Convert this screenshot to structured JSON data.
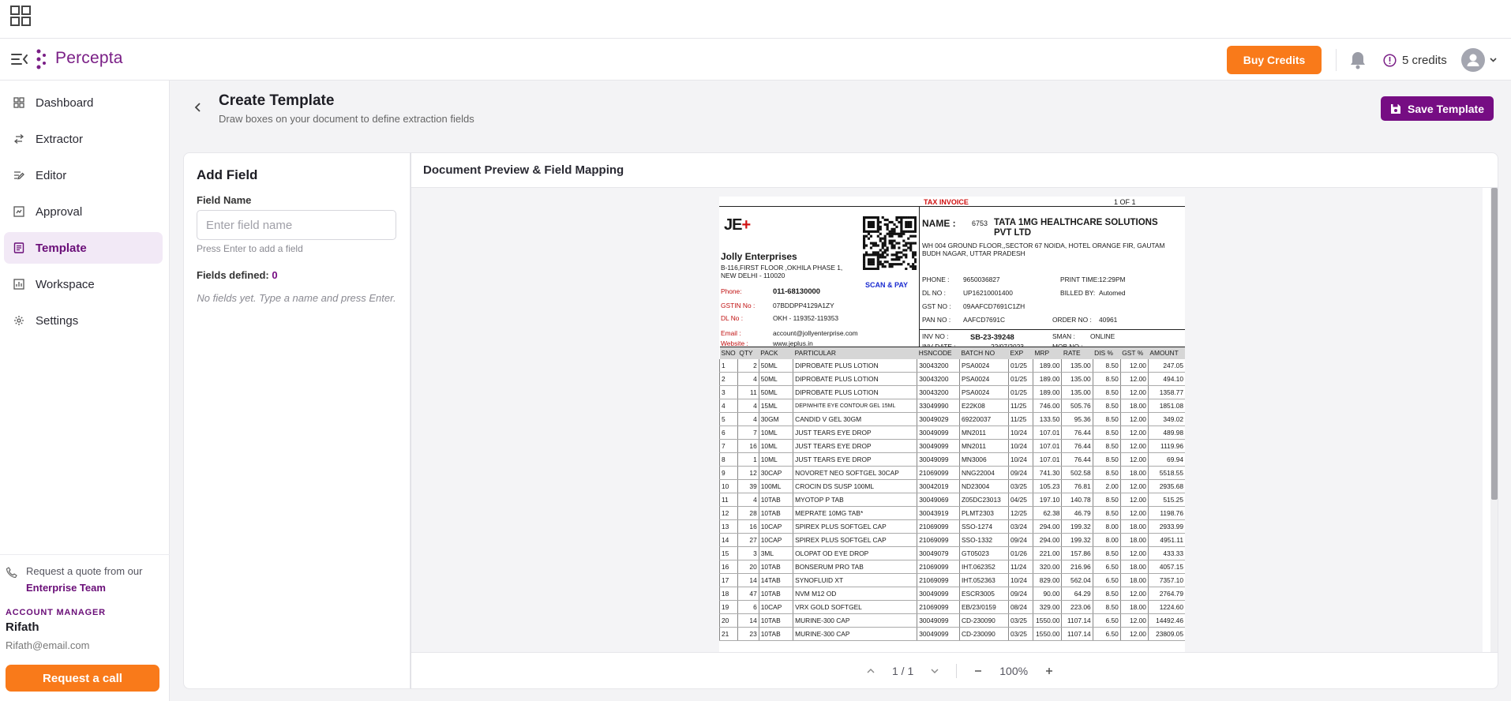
{
  "app": {
    "brand": "Percepta",
    "buy_credits": "Buy Credits",
    "credits": "5 credits"
  },
  "sidebar": {
    "items": [
      {
        "label": "Dashboard",
        "icon": "dashboard-icon"
      },
      {
        "label": "Extractor",
        "icon": "arrows-icon"
      },
      {
        "label": "Editor",
        "icon": "edit-list-icon"
      },
      {
        "label": "Approval",
        "icon": "approval-icon"
      },
      {
        "label": "Template",
        "icon": "template-icon",
        "active": true
      },
      {
        "label": "Workspace",
        "icon": "workspace-icon"
      },
      {
        "label": "Settings",
        "icon": "gear-icon"
      }
    ],
    "quote_text": "Request a quote from our",
    "quote_link": "Enterprise Team",
    "account_label": "ACCOUNT MANAGER",
    "account_name": "Rifath",
    "account_email": "Rifath@email.com",
    "request_call": "Request a call"
  },
  "main": {
    "title": "Create Template",
    "subtitle": "Draw boxes on your document to define extraction fields",
    "save_label": "Save Template"
  },
  "add_field": {
    "title": "Add Field",
    "field_label": "Field Name",
    "placeholder": "Enter field name",
    "hint": "Press Enter to add a field",
    "defined_label": "Fields defined:",
    "defined_count": "0",
    "empty": "No fields yet. Type a name and press Enter."
  },
  "preview": {
    "title": "Document Preview & Field Mapping",
    "page_indicator": "1 / 1",
    "zoom": "100%"
  },
  "invoice": {
    "tax_invoice": "TAX INVOICE",
    "page_of": "1 OF   1",
    "seller": {
      "name": "Jolly Enterprises",
      "address": "B-116,FIRST FLOOR ,OKHILA PHASE 1, NEW DELHI - 110020",
      "phone_label": "Phone:",
      "phone": "011-68130000",
      "gstin_label": "GSTIN No :",
      "gstin": "07BDDPP4129A1ZY",
      "dl_label": "DL No :",
      "dl": "OKH - 119352-119353",
      "email_label": "Email :",
      "email": "account@jollyenterprise.com",
      "website_label": "Website :",
      "website": "www.jeplus.in",
      "scan_pay": "SCAN & PAY"
    },
    "buyer": {
      "name_label": "NAME  :",
      "code": "6753",
      "name": "TATA 1MG HEALTHCARE SOLUTIONS PVT LTD",
      "address": "WH 004 GROUND FLOOR,,SECTOR 67 NOIDA, HOTEL ORANGE FIR, GAUTAM BUDH NAGAR, UTTAR PRADESH",
      "phone_label": "PHONE   :",
      "phone": "9650036827",
      "print_label": "PRINT TIME:",
      "print_time": "12:29PM",
      "dl_label": "DL NO   :",
      "dl": "UP16210001400",
      "billed_label": "BILLED BY:",
      "billed_by": "Automed",
      "gst_label": "GST NO  :",
      "gst": "09AAFCD7691C1ZH",
      "pan_label": "PAN NO  :",
      "pan": "AAFCD7691C",
      "order_label": "ORDER NO  :",
      "order": "40961",
      "inv_no_label": "INV NO    :",
      "inv_no": "SB-23-39248",
      "sman_label": "SMAN    :",
      "sman": "ONLINE",
      "inv_date_label": "INV DATE  :",
      "inv_date": "22/07/2023",
      "mob_label": "MOB NO  :",
      "mob": ""
    },
    "columns": [
      "SNO",
      "QTY",
      "PACK",
      "PARTICULAR",
      "HSNCODE",
      "BATCH NO",
      "EXP",
      "MRP",
      "RATE",
      "DIS %",
      "GST %",
      "AMOUNT"
    ],
    "rows": [
      [
        "1",
        "2",
        "50ML",
        "DIPROBATE PLUS LOTION",
        "30043200",
        "PSA0024",
        "01/25",
        "189.00",
        "135.00",
        "8.50",
        "12.00",
        "247.05"
      ],
      [
        "2",
        "4",
        "50ML",
        "DIPROBATE PLUS LOTION",
        "30043200",
        "PSA0024",
        "01/25",
        "189.00",
        "135.00",
        "8.50",
        "12.00",
        "494.10"
      ],
      [
        "3",
        "11",
        "50ML",
        "DIPROBATE PLUS LOTION",
        "30043200",
        "PSA0024",
        "01/25",
        "189.00",
        "135.00",
        "8.50",
        "12.00",
        "1358.77"
      ],
      [
        "4",
        "4",
        "15ML",
        "DEPIWHITE EYE CONTOUR GEL 15ML",
        "33049990",
        "E22K08",
        "11/25",
        "746.00",
        "505.76",
        "8.50",
        "18.00",
        "1851.08"
      ],
      [
        "5",
        "4",
        "30GM",
        "CANDID V GEL 30GM",
        "30049029",
        "69220037",
        "11/25",
        "133.50",
        "95.36",
        "8.50",
        "12.00",
        "349.02"
      ],
      [
        "6",
        "7",
        "10ML",
        "JUST TEARS EYE DROP",
        "30049099",
        "MN2011",
        "10/24",
        "107.01",
        "76.44",
        "8.50",
        "12.00",
        "489.98"
      ],
      [
        "7",
        "16",
        "10ML",
        "JUST TEARS EYE DROP",
        "30049099",
        "MN2011",
        "10/24",
        "107.01",
        "76.44",
        "8.50",
        "12.00",
        "1119.96"
      ],
      [
        "8",
        "1",
        "10ML",
        "JUST TEARS EYE DROP",
        "30049099",
        "MN3006",
        "10/24",
        "107.01",
        "76.44",
        "8.50",
        "12.00",
        "69.94"
      ],
      [
        "9",
        "12",
        "30CAP",
        "NOVORET NEO SOFTGEL 30CAP",
        "21069099",
        "NNG22004",
        "09/24",
        "741.30",
        "502.58",
        "8.50",
        "18.00",
        "5518.55"
      ],
      [
        "10",
        "39",
        "100ML",
        "CROCIN DS SUSP 100ML",
        "30042019",
        "ND23004",
        "03/25",
        "105.23",
        "76.81",
        "2.00",
        "12.00",
        "2935.68"
      ],
      [
        "11",
        "4",
        "10TAB",
        "MYOTOP P TAB",
        "30049069",
        "Z05DC23013",
        "04/25",
        "197.10",
        "140.78",
        "8.50",
        "12.00",
        "515.25"
      ],
      [
        "12",
        "28",
        "10TAB",
        "MEPRATE 10MG TAB*",
        "30043919",
        "PLMT2303",
        "12/25",
        "62.38",
        "46.79",
        "8.50",
        "12.00",
        "1198.76"
      ],
      [
        "13",
        "16",
        "10CAP",
        "SPIREX PLUS SOFTGEL CAP",
        "21069099",
        "SSO-1274",
        "03/24",
        "294.00",
        "199.32",
        "8.00",
        "18.00",
        "2933.99"
      ],
      [
        "14",
        "27",
        "10CAP",
        "SPIREX PLUS SOFTGEL CAP",
        "21069099",
        "SSO-1332",
        "09/24",
        "294.00",
        "199.32",
        "8.00",
        "18.00",
        "4951.11"
      ],
      [
        "15",
        "3",
        "3ML",
        "OLOPAT OD EYE DROP",
        "30049079",
        "GT05023",
        "01/26",
        "221.00",
        "157.86",
        "8.50",
        "12.00",
        "433.33"
      ],
      [
        "16",
        "20",
        "10TAB",
        "BONSERUM PRO TAB",
        "21069099",
        "IHT.062352",
        "11/24",
        "320.00",
        "216.96",
        "6.50",
        "18.00",
        "4057.15"
      ],
      [
        "17",
        "14",
        "14TAB",
        "SYNOFLUID XT",
        "21069099",
        "IHT.052363",
        "10/24",
        "829.00",
        "562.04",
        "6.50",
        "18.00",
        "7357.10"
      ],
      [
        "18",
        "47",
        "10TAB",
        "NVM  M12 OD",
        "30049099",
        "ESCR3005",
        "09/24",
        "90.00",
        "64.29",
        "8.50",
        "12.00",
        "2764.79"
      ],
      [
        "19",
        "6",
        "10CAP",
        "VRX GOLD SOFTGEL",
        "21069099",
        "EB/23/0159",
        "08/24",
        "329.00",
        "223.06",
        "8.50",
        "18.00",
        "1224.60"
      ],
      [
        "20",
        "14",
        "10TAB",
        "MURINE-300 CAP",
        "30049099",
        "CD-230090",
        "03/25",
        "1550.00",
        "1107.14",
        "6.50",
        "12.00",
        "14492.46"
      ],
      [
        "21",
        "23",
        "10TAB",
        "MURINE-300 CAP",
        "30049099",
        "CD-230090",
        "03/25",
        "1550.00",
        "1107.14",
        "6.50",
        "12.00",
        "23809.05"
      ]
    ]
  },
  "colors": {
    "brand": "#7a1f86",
    "accent": "#f97a1a",
    "primary": "#760d83"
  }
}
